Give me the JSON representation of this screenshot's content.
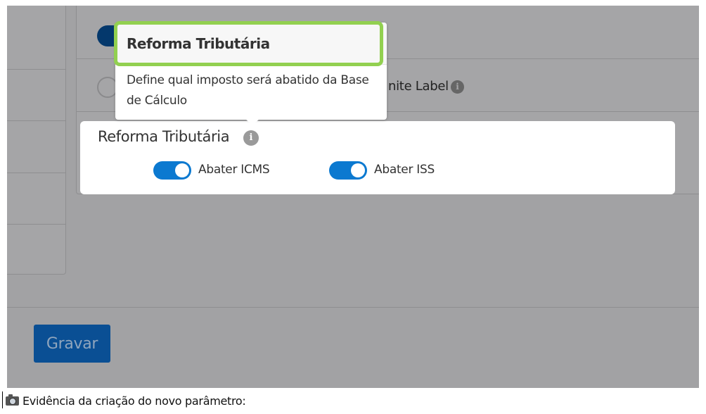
{
  "background": {
    "white_label_text": "nite Label",
    "save_button_label": "Gravar"
  },
  "tooltip": {
    "title": "Reforma Tributária",
    "body": "Define qual imposto será abatido da Base de Cálculo"
  },
  "tax_panel": {
    "title": "Reforma Tributária",
    "info_icon": "info-icon",
    "switches": [
      {
        "label": "Abater ICMS",
        "checked": true
      },
      {
        "label": "Abater ISS",
        "checked": true
      }
    ]
  },
  "caption": {
    "icon": "camera-icon",
    "text": "Evidência da criação do novo parâmetro:"
  },
  "colors": {
    "highlight": "#92d050",
    "switch_on": "#0b79d0",
    "overlay": "#a2a2a4",
    "save_button": "#0a4f94"
  }
}
